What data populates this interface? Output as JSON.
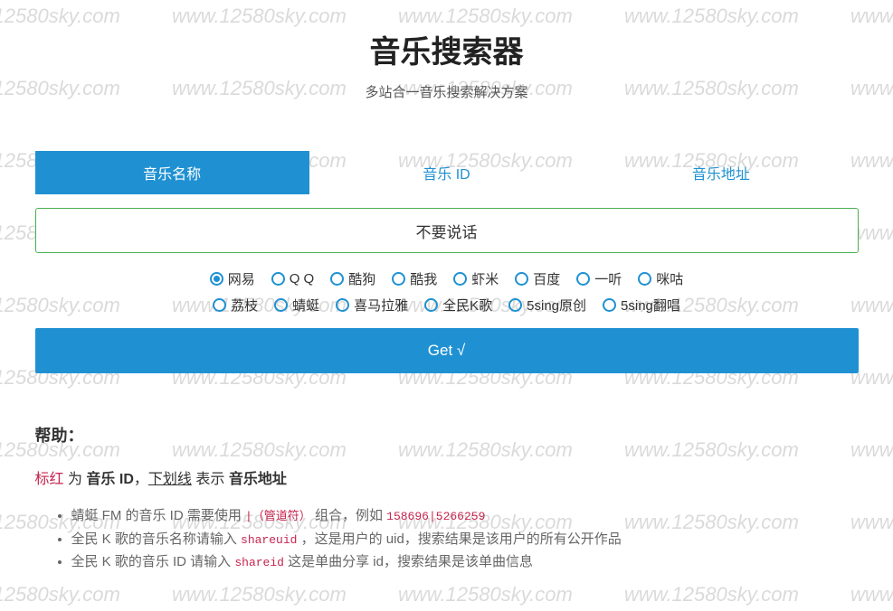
{
  "watermark_text": "www.12580sky.com",
  "header": {
    "title": "音乐搜索器",
    "subtitle": "多站合一音乐搜索解决方案"
  },
  "tabs": [
    {
      "label": "音乐名称",
      "active": true
    },
    {
      "label": "音乐 ID",
      "active": false
    },
    {
      "label": "音乐地址",
      "active": false
    }
  ],
  "search": {
    "value": "不要说话"
  },
  "sources_row1": [
    {
      "label": "网易",
      "selected": true
    },
    {
      "label": "Q Q",
      "selected": false
    },
    {
      "label": "酷狗",
      "selected": false
    },
    {
      "label": "酷我",
      "selected": false
    },
    {
      "label": "虾米",
      "selected": false
    },
    {
      "label": "百度",
      "selected": false
    },
    {
      "label": "一听",
      "selected": false
    },
    {
      "label": "咪咕",
      "selected": false
    }
  ],
  "sources_row2": [
    {
      "label": "荔枝",
      "selected": false
    },
    {
      "label": "蜻蜓",
      "selected": false
    },
    {
      "label": "喜马拉雅",
      "selected": false
    },
    {
      "label": "全民K歌",
      "selected": false
    },
    {
      "label": "5sing原创",
      "selected": false
    },
    {
      "label": "5sing翻唱",
      "selected": false
    }
  ],
  "button": {
    "label": "Get √"
  },
  "help": {
    "title": "帮助：",
    "line_parts": {
      "p1": "标红",
      "p2": " 为 ",
      "p3": "音乐 ID",
      "p4": "，",
      "p5": "下划线",
      "p6": " 表示 ",
      "p7": "音乐地址"
    },
    "items": [
      {
        "t1": "蜻蜓 FM 的音乐 ID 需要使用 ",
        "c1": "|（管道符）",
        "t2": " 组合，例如 ",
        "c2": "158696|5266259"
      },
      {
        "t1": "全民 K 歌的音乐名称请输入 ",
        "c1": "shareuid",
        "t2": " ，这是用户的 uid，搜索结果是该用户的所有公开作品"
      },
      {
        "t1": "全民 K 歌的音乐 ID 请输入 ",
        "c1": "shareid",
        "t2": " 这是单曲分享 id，搜索结果是该单曲信息"
      }
    ]
  }
}
